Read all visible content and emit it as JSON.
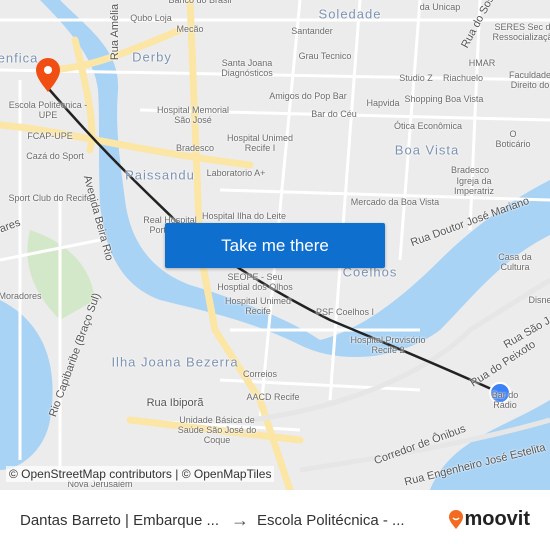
{
  "map": {
    "area_labels": [
      "Soledade",
      "Derby",
      "Paissandu",
      "Boa Vista",
      "Coelhos",
      "Ilha Joana Bezerra",
      "enfica"
    ],
    "poi_labels": [
      "Qubo Loja",
      "Mecão",
      "Banco do Brasil",
      "Santander",
      "Grau Tecnico",
      "Santa Joana Diagnósticos",
      "Hospital Memorial São José",
      "Amigos do Pop Bar",
      "Bar do Céu",
      "Hapvida",
      "Studio Z",
      "Riachuelo",
      "Shopping Boa Vista",
      "HMAR",
      "Ótica Econômica",
      "O Boticário",
      "Bradesco",
      "Hospital Unimed Recife I",
      "Laboratorio A+",
      "Bradesco",
      "Igreja da Imperatriz",
      "Mercado da Boa Vista",
      "Hospital Ilha do Leite",
      "Real Hospital Português",
      "Escola Politécnica - UPE",
      "FCAP-UPE",
      "Cazá do Sport",
      "Sport Club do Recife",
      "SEOPE - Seu Hosptial dos Olhos",
      "Hospital Unimed Recife",
      "PSF Coelhos I",
      "Hospital Provisório Recife 2",
      "Correios",
      "AACD Recife",
      "Unidade Básica de Saúde São José do Coque",
      "Casa da Cultura",
      "Bar do Rádio",
      "SERES Sec de Ressocialização",
      "da Unicap",
      "Faculdade Direito do",
      "Moradores",
      "Disne",
      "Nova Jerusalém"
    ],
    "street_labels": [
      "Rua Amélia",
      "Avenida Beira Rio",
      "Rua Doutor José Mariano",
      "Rua do Peixoto",
      "Rua São J",
      "Corredor de Ônibus",
      "Rua Engenheiro José Estelita",
      "Rua Ibiporã",
      "Rio Capibaribe (Braço Sul)",
      "Rua do Sos",
      "ares"
    ],
    "destination_marker_color": "#f04e12",
    "origin_marker_color": "#3b82f6",
    "route_color": "#222222",
    "water_color": "#a9d3f5",
    "road_color": "#fbe6a6"
  },
  "cta": {
    "label": "Take me there",
    "color": "#0f6fcf"
  },
  "attribution": "© OpenStreetMap contributors | © OpenMapTiles",
  "trip": {
    "origin": "Dantas Barreto | Embarque ...",
    "arrow": "→",
    "destination": "Escola Politécnica - ...",
    "brand": "moovit",
    "brand_color": "#f26b21"
  }
}
